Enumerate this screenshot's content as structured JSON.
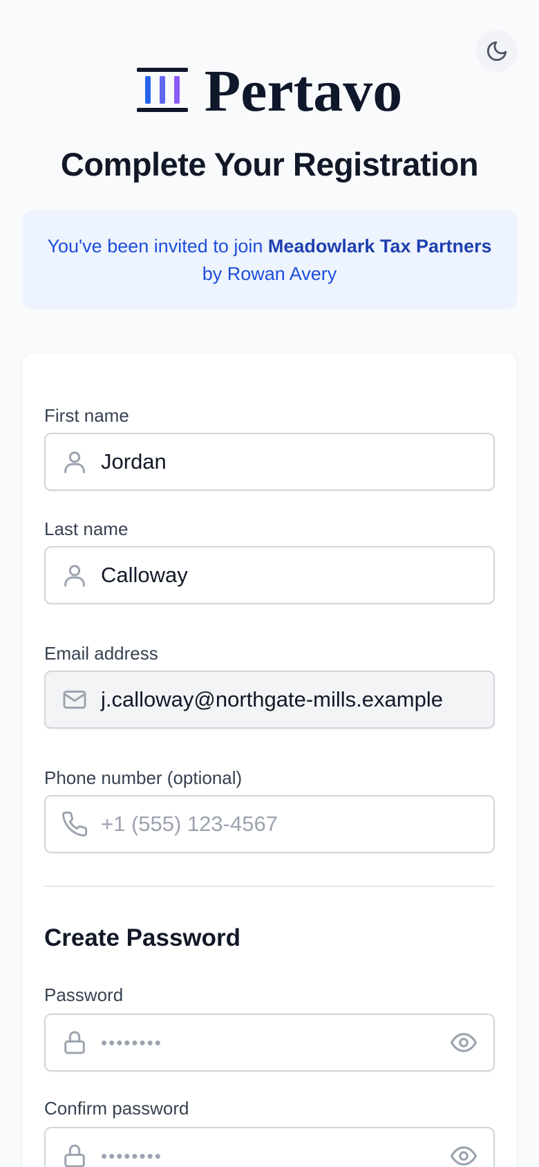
{
  "branding": {
    "name": "Pertavo",
    "logo_colors": [
      "#2563eb",
      "#6366f1",
      "#8b5cf6"
    ]
  },
  "header": {
    "theme_toggle_icon": "moon-icon",
    "title": "Complete Your Registration"
  },
  "invite": {
    "prefix": "You've been invited to join",
    "organization": "Meadowlark Tax Partners",
    "suffix": "by Rowan Avery"
  },
  "form": {
    "first_name": {
      "label": "First name",
      "value": "Jordan",
      "icon": "user-icon"
    },
    "last_name": {
      "label": "Last name",
      "value": "Calloway",
      "icon": "user-icon"
    },
    "email": {
      "label": "Email address",
      "value": "j.calloway@northgate-mills.example",
      "icon": "mail-icon",
      "readonly": true
    },
    "phone": {
      "label": "Phone number (optional)",
      "placeholder": "+1 (555) 123-4567",
      "icon": "phone-icon"
    },
    "password_section": {
      "title": "Create Password",
      "password": {
        "label": "Password",
        "placeholder": "••••••••",
        "icon": "lock-icon",
        "toggle_icon": "eye-icon"
      },
      "confirm": {
        "label": "Confirm password",
        "placeholder": "••••••••",
        "icon": "lock-icon",
        "toggle_icon": "eye-icon"
      }
    }
  },
  "colors": {
    "accent": "#1d4ed8",
    "banner_bg": "#eef4fe",
    "page_bg": "#f8fafc"
  }
}
